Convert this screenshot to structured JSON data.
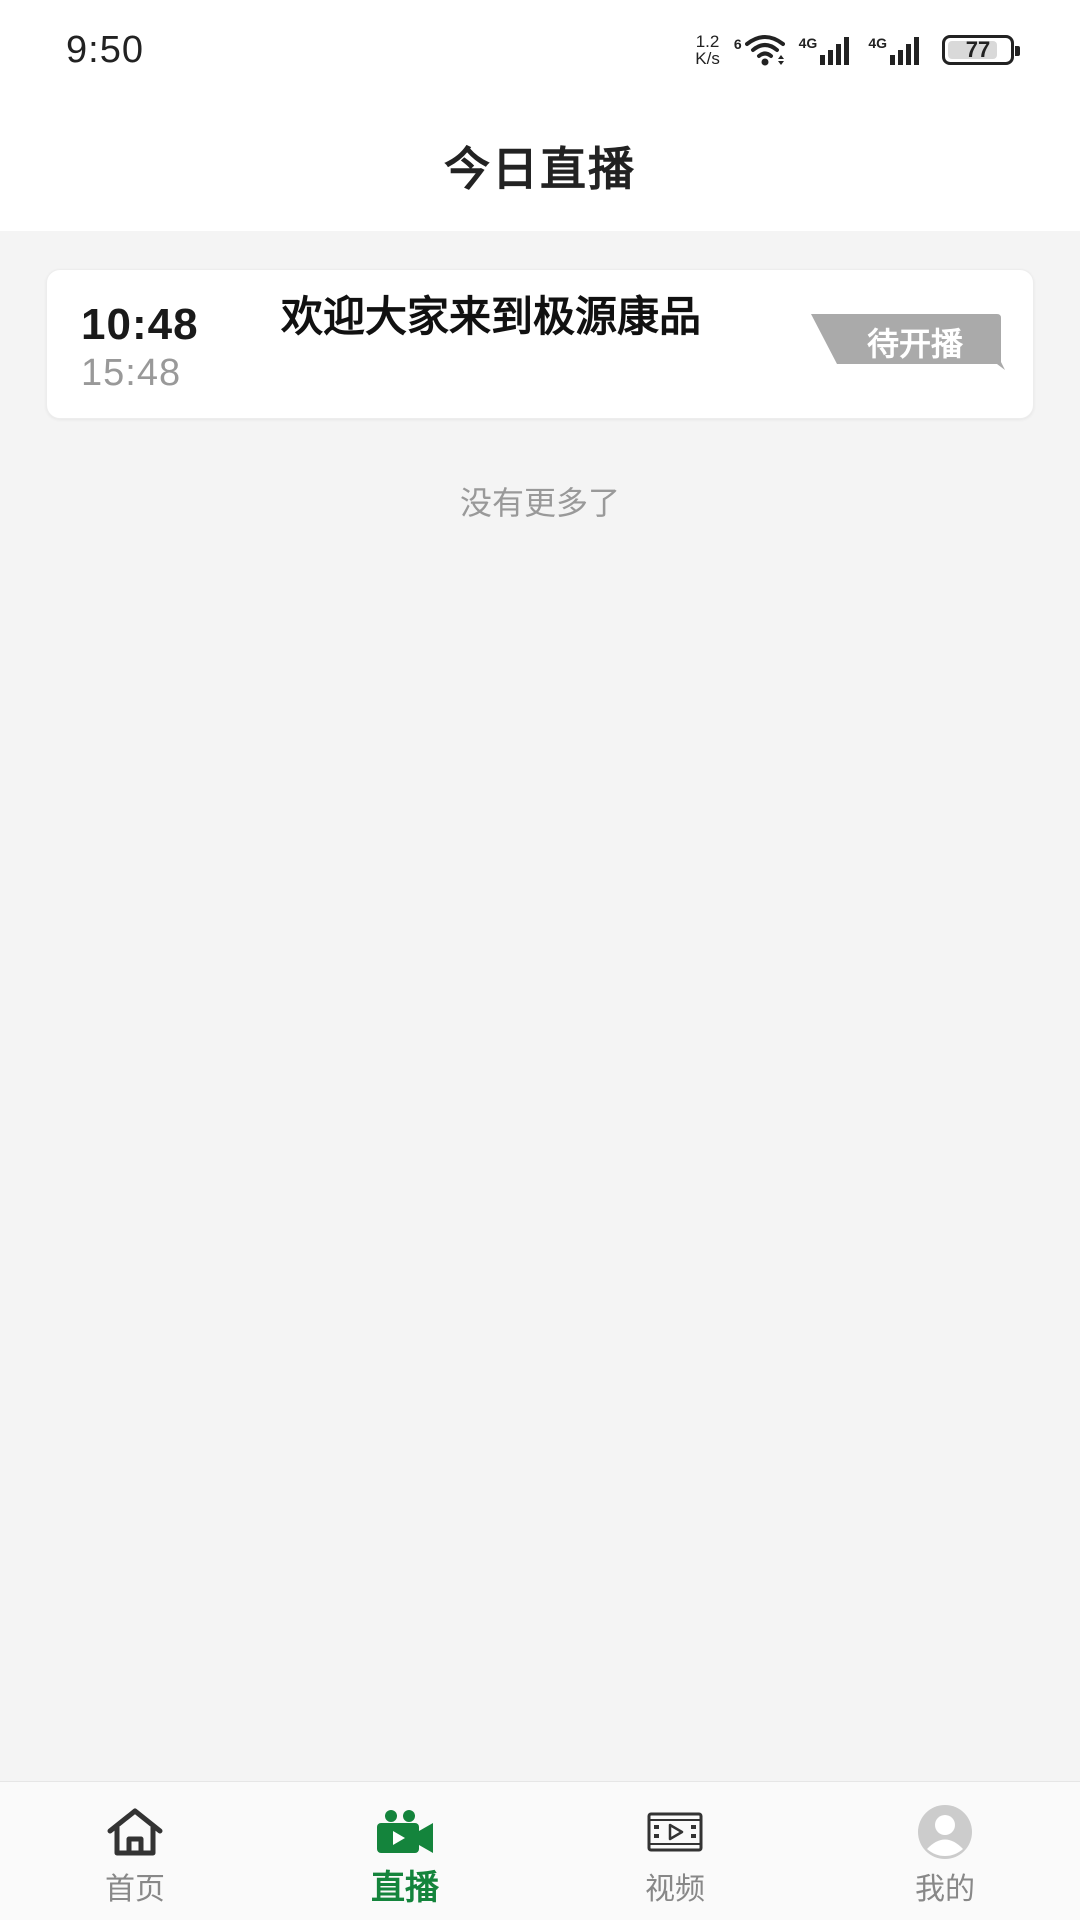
{
  "status_bar": {
    "time": "9:50",
    "net_speed_value": "1.2",
    "net_speed_unit": "K/s",
    "wifi_label": "6",
    "sim1_label": "4G",
    "sim2_label": "4G",
    "battery": "77"
  },
  "header": {
    "title": "今日直播"
  },
  "live_list": [
    {
      "start_time": "10:48",
      "end_time": "15:48",
      "title": "欢迎大家来到极源康品",
      "status": "待开播"
    }
  ],
  "list_footer": "没有更多了",
  "bottom_nav": {
    "items": [
      {
        "label": "首页",
        "icon": "home-icon",
        "active": false
      },
      {
        "label": "直播",
        "icon": "video-camera-icon",
        "active": true
      },
      {
        "label": "视频",
        "icon": "film-icon",
        "active": false
      },
      {
        "label": "我的",
        "icon": "user-avatar-icon",
        "active": false
      }
    ]
  },
  "colors": {
    "accent": "#14843c",
    "status_tag": "#aaaaaa",
    "background": "#f4f4f4"
  }
}
